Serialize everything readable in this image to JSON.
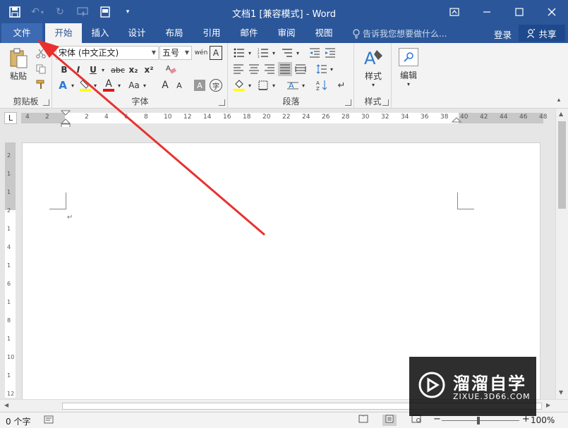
{
  "titlebar": {
    "title": "文档1 [兼容模式] - Word",
    "qat": {
      "save_icon": "save-icon",
      "undo_icon": "undo-icon",
      "redo_icon": "redo-icon",
      "touch_icon": "touch-mode-icon",
      "print_icon": "print-preview-icon",
      "customize_icon": "customize-qat-icon"
    },
    "window_controls": {
      "ribbon_display": "ribbon-display-icon",
      "minimize": "minimize-icon",
      "maximize": "maximize-icon",
      "close": "close-icon"
    }
  },
  "tabs": {
    "file": "文件",
    "home": "开始",
    "insert": "插入",
    "design": "设计",
    "layout": "布局",
    "references": "引用",
    "mailings": "邮件",
    "review": "审阅",
    "view": "视图"
  },
  "tellme": "告诉我您想要做什么...",
  "login": "登录",
  "share": "共享",
  "ribbon": {
    "clipboard": {
      "label": "剪贴板",
      "paste": "粘贴"
    },
    "font": {
      "label": "字体",
      "font_name": "宋体 (中文正文)",
      "font_size": "五号",
      "bold": "B",
      "italic": "I",
      "underline": "U",
      "strike": "abc",
      "subscript": "x₂",
      "superscript": "x²",
      "case": "Aa",
      "grow": "A",
      "shrink": "A",
      "font_color": "A"
    },
    "paragraph": {
      "label": "段落"
    },
    "styles": {
      "label": "样式",
      "button": "样式"
    },
    "editing": {
      "button": "编辑"
    }
  },
  "ruler": {
    "corner": "L",
    "h_numbers": [
      "4",
      "2",
      "2",
      "4",
      "6",
      "8",
      "10",
      "12",
      "14",
      "16",
      "18",
      "20",
      "22",
      "24",
      "26",
      "28",
      "30",
      "32",
      "34",
      "36",
      "38",
      "40",
      "42",
      "44",
      "46",
      "48"
    ],
    "v_numbers": [
      "2",
      "1",
      "1",
      "2",
      "1",
      "4",
      "1",
      "6",
      "1",
      "8",
      "1",
      "10",
      "1",
      "12"
    ]
  },
  "document": {
    "para_mark": "↵"
  },
  "status": {
    "word_count": "0 个字",
    "zoom": "100%"
  },
  "watermark": {
    "brand": "溜溜自学",
    "site": "ZIXUE.3D66.COM"
  },
  "colors": {
    "accent": "#2b579a",
    "arrow": "#e8312f"
  }
}
